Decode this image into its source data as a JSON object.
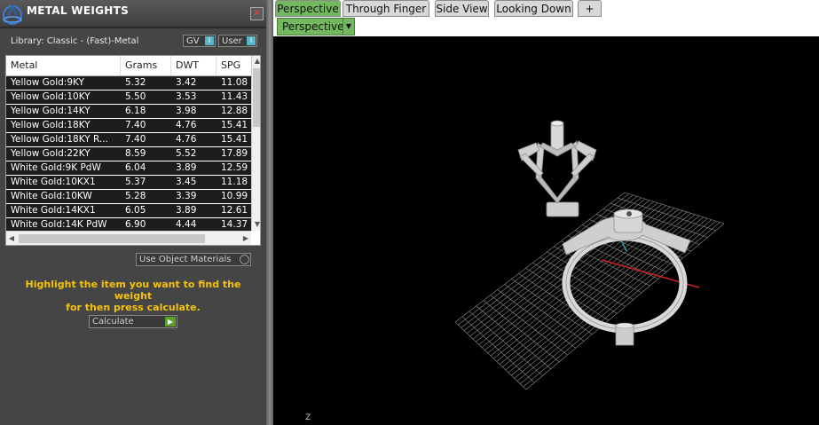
{
  "panel": {
    "title": "METAL WEIGHTS",
    "close_glyph": "✕",
    "library_label": "Library: Classic - (Fast)-Metal",
    "toggle_gv": "GV",
    "toggle_user": "User",
    "toggle_mark": "I"
  },
  "table": {
    "columns": [
      "Metal",
      "Grams",
      "DWT",
      "SPG"
    ],
    "rows": [
      [
        "Yellow Gold:9KY",
        "5.32",
        "3.42",
        "11.08"
      ],
      [
        "Yellow Gold:10KY",
        "5.50",
        "3.53",
        "11.43"
      ],
      [
        "Yellow Gold:14KY",
        "6.18",
        "3.98",
        "12.88"
      ],
      [
        "Yellow Gold:18KY",
        "7.40",
        "4.76",
        "15.41"
      ],
      [
        "Yellow Gold:18KY R...",
        "7.40",
        "4.76",
        "15.41"
      ],
      [
        "Yellow Gold:22KY",
        "8.59",
        "5.52",
        "17.89"
      ],
      [
        "White Gold:9K PdW",
        "6.04",
        "3.89",
        "12.59"
      ],
      [
        "White Gold:10KX1",
        "5.37",
        "3.45",
        "11.18"
      ],
      [
        "White Gold:10KW",
        "5.28",
        "3.39",
        "10.99"
      ],
      [
        "White Gold:14KX1",
        "6.05",
        "3.89",
        "12.61"
      ],
      [
        "White Gold:14K PdW",
        "6.90",
        "4.44",
        "14.37"
      ]
    ]
  },
  "controls": {
    "use_object_materials": "Use Object Materials",
    "hint_line1": "Highlight the item you want to find the weight",
    "hint_line2": "for then press calculate.",
    "calculate": "Calculate"
  },
  "viewport": {
    "tabs": [
      "Perspective",
      "Through Finger",
      "Side View",
      "Looking Down",
      "+"
    ],
    "active_tab": "Perspective",
    "view_select": "Perspective",
    "axis_label": "Z"
  },
  "colors": {
    "accent_green": "#73b85e",
    "hint_yellow": "#f4c20d",
    "x_axis_red": "#cc2020",
    "y_axis_cyan": "#3a9ab0"
  }
}
